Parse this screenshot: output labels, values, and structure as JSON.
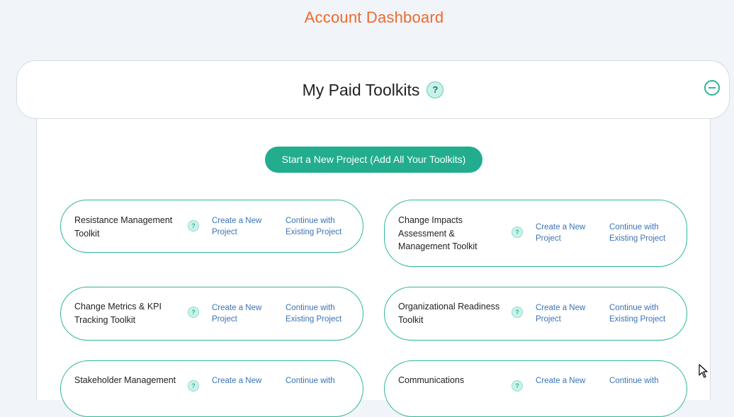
{
  "page": {
    "title": "Account Dashboard"
  },
  "panel": {
    "title": "My Paid Toolkits",
    "help_icon": "question-icon",
    "collapse_icon": "minus-circle-icon"
  },
  "start_button": {
    "label": "Start a New Project (Add All Your Toolkits)"
  },
  "help_glyph": "?",
  "toolkits": [
    {
      "name": "Resistance Management Toolkit",
      "create": "Create a New Project",
      "continue": "Continue with Existing Project"
    },
    {
      "name": "Change Impacts Assessment & Management Toolkit",
      "create": "Create a New Project",
      "continue": "Continue with Existing Project"
    },
    {
      "name": "Change Metrics & KPI Tracking Toolkit",
      "create": "Create a New Project",
      "continue": "Continue with Existing Project"
    },
    {
      "name": "Organizational Readiness Toolkit",
      "create": "Create a New Project",
      "continue": "Continue with Existing Project"
    },
    {
      "name": "Stakeholder Management",
      "create": "Create a New",
      "continue": "Continue with"
    },
    {
      "name": "Communications",
      "create": "Create a New",
      "continue": "Continue with"
    }
  ],
  "colors": {
    "accent": "#22ad8f",
    "title": "#ee6a2a",
    "link": "#3a73b7"
  }
}
